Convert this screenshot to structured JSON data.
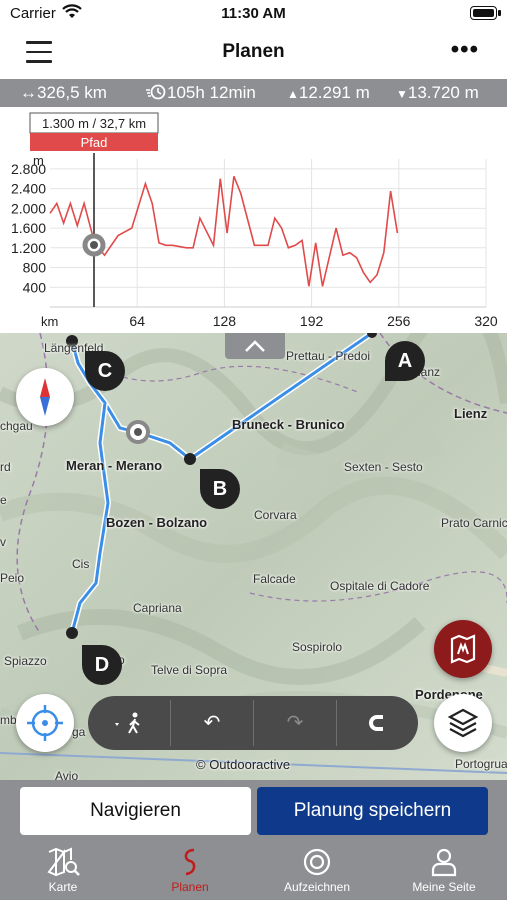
{
  "status_bar": {
    "carrier": "Carrier",
    "time": "11:30 AM"
  },
  "header": {
    "title": "Planen"
  },
  "stats": {
    "distance": "326,5 km",
    "duration": "105h 12min",
    "ascent": "12.291 m",
    "descent": "13.720 m"
  },
  "elevation": {
    "tooltip_value": "1.300 m / 32,7 km",
    "tooltip_surface": "Pfad",
    "unit": "m",
    "y_ticks": [
      "2.800",
      "2.400",
      "2.000",
      "1.600",
      "1.200",
      "800",
      "400"
    ],
    "x_unit": "km",
    "x_ticks": [
      "64",
      "128",
      "192",
      "256",
      "320"
    ],
    "colors": {
      "trail_red": "#e14a4a",
      "trail_black": "#222222",
      "trail_blue": "#3a6fd8",
      "trail_green": "#3a9a3a"
    }
  },
  "chart_data": {
    "type": "line",
    "title": "",
    "xlabel": "km",
    "ylabel": "m",
    "xlim": [
      0,
      320
    ],
    "ylim": [
      0,
      3000
    ],
    "x": [
      0,
      5,
      10,
      15,
      20,
      25,
      32.7,
      40,
      50,
      60,
      70,
      75,
      80,
      85,
      90,
      100,
      105,
      110,
      120,
      125,
      130,
      135,
      140,
      150,
      160,
      165,
      170,
      175,
      180,
      185,
      190,
      195,
      200,
      210,
      215,
      220,
      225,
      230,
      235,
      240,
      245,
      250,
      255
    ],
    "series": [
      {
        "values": [
          1900,
          2100,
          1700,
          2100,
          1650,
          2100,
          1300,
          1050,
          1450,
          1600,
          2500,
          2100,
          1300,
          1250,
          1250,
          1200,
          1200,
          1800,
          1250,
          2600,
          1500,
          2650,
          2300,
          1250,
          1250,
          1800,
          1600,
          1200,
          1250,
          1350,
          420,
          1300,
          420,
          1600,
          1050,
          1100,
          1000,
          700,
          500,
          650,
          1100,
          2350,
          1500
        ]
      }
    ]
  },
  "map": {
    "collapse": "︿",
    "places": {
      "langenfeld": "Längenfeld",
      "prettau": "Prettau - Predoi",
      "lienz": "Lienz",
      "bruneck": "Bruneck - Brunico",
      "meran": "Meran - Merano",
      "sexten": "Sexten - Sesto",
      "bozen": "Bozen - Bolzano",
      "corvara": "Corvara",
      "prato": "Prato Carnico",
      "cis": "Cis",
      "falcade": "Falcade",
      "ospitale": "Ospitale di Cadore",
      "capriana": "Capriana",
      "sospirolo": "Sospirolo",
      "spiazzo": "Spiazzo",
      "telve": "Telve di Sopra",
      "pordenone": "Pordenone",
      "portogrua": "Portogrua",
      "peio": "Peio",
      "avio": "Avio",
      "chgau": "chgau",
      "lanz": "lanz",
      "rd": "rd",
      "edge_e": "e",
      "edge_v": "v",
      "mbl": "mbl",
      "ga": "ga",
      "d_suffix": "o"
    },
    "waypoints": [
      "A",
      "B",
      "C",
      "D"
    ],
    "copyright": "© Outdooractive",
    "route_color": "#3a8ee8"
  },
  "toolbar": {
    "mode_label": "walk-mode",
    "undo": "↶",
    "redo": "↷",
    "snap": "magnet"
  },
  "actions": {
    "navigate": "Navigieren",
    "save": "Planung speichern"
  },
  "tabs": [
    {
      "label": "Karte"
    },
    {
      "label": "Planen"
    },
    {
      "label": "Aufzeichnen"
    },
    {
      "label": "Meine Seite"
    }
  ]
}
